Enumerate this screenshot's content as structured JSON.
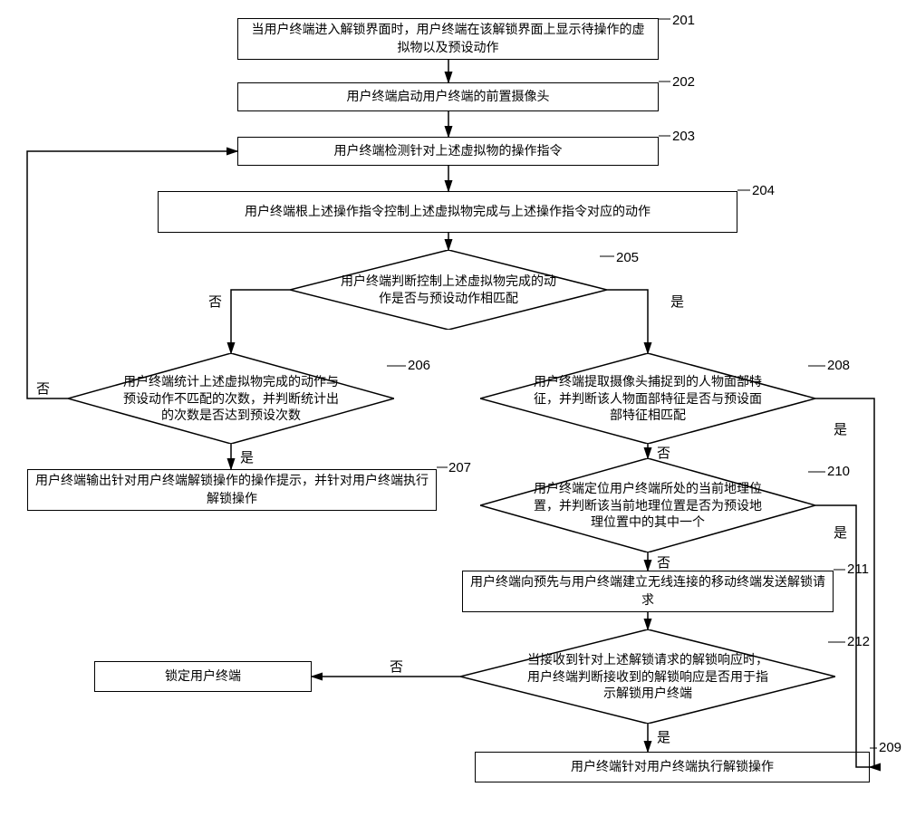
{
  "nodes": {
    "n201": "当用户终端进入解锁界面时，用户终端在该解锁界面上显示待操作的虚拟物以及预设动作",
    "n202": "用户终端启动用户终端的前置摄像头",
    "n203": "用户终端检测针对上述虚拟物的操作指令",
    "n204": "用户终端根上述操作指令控制上述虚拟物完成与上述操作指令对应的动作",
    "n205": "用户终端判断控制上述虚拟物完成的动作是否与预设动作相匹配",
    "n206": "用户终端统计上述虚拟物完成的动作与预设动作不匹配的次数，并判断统计出的次数是否达到预设次数",
    "n207": "用户终端输出针对用户终端解锁操作的操作提示，并针对用户终端执行解锁操作",
    "n208": "用户终端提取摄像头捕捉到的人物面部特征，并判断该人物面部特征是否与预设面部特征相匹配",
    "n209": "用户终端针对用户终端执行解锁操作",
    "n210": "用户终端定位用户终端所处的当前地理位置，并判断该当前地理位置是否为预设地理位置中的其中一个",
    "n211": "用户终端向预先与用户终端建立无线连接的移动终端发送解锁请求",
    "n212": "当接收到针对上述解锁请求的解锁响应时，用户终端判断接收到的解锁响应是否用于指示解锁用户终端",
    "nlock": "锁定用户终端"
  },
  "labels": {
    "l201": "201",
    "l202": "202",
    "l203": "203",
    "l204": "204",
    "l205": "205",
    "l206": "206",
    "l207": "207",
    "l208": "208",
    "l209": "209",
    "l210": "210",
    "l211": "211",
    "l212": "212"
  },
  "yn": {
    "yes": "是",
    "no": "否"
  },
  "chart_data": {
    "type": "flowchart",
    "nodes": [
      {
        "id": "201",
        "shape": "process",
        "text": "当用户终端进入解锁界面时，用户终端在该解锁界面上显示待操作的虚拟物以及预设动作"
      },
      {
        "id": "202",
        "shape": "process",
        "text": "用户终端启动用户终端的前置摄像头"
      },
      {
        "id": "203",
        "shape": "process",
        "text": "用户终端检测针对上述虚拟物的操作指令"
      },
      {
        "id": "204",
        "shape": "process",
        "text": "用户终端根上述操作指令控制上述虚拟物完成与上述操作指令对应的动作"
      },
      {
        "id": "205",
        "shape": "decision",
        "text": "用户终端判断控制上述虚拟物完成的动作是否与预设动作相匹配"
      },
      {
        "id": "206",
        "shape": "decision",
        "text": "用户终端统计上述虚拟物完成的动作与预设动作不匹配的次数，并判断统计出的次数是否达到预设次数"
      },
      {
        "id": "207",
        "shape": "process",
        "text": "用户终端输出针对用户终端解锁操作的操作提示，并针对用户终端执行解锁操作"
      },
      {
        "id": "208",
        "shape": "decision",
        "text": "用户终端提取摄像头捕捉到的人物面部特征，并判断该人物面部特征是否与预设面部特征相匹配"
      },
      {
        "id": "210",
        "shape": "decision",
        "text": "用户终端定位用户终端所处的当前地理位置，并判断该当前地理位置是否为预设地理位置中的其中一个"
      },
      {
        "id": "211",
        "shape": "process",
        "text": "用户终端向预先与用户终端建立无线连接的移动终端发送解锁请求"
      },
      {
        "id": "212",
        "shape": "decision",
        "text": "当接收到针对上述解锁请求的解锁响应时，用户终端判断接收到的解锁响应是否用于指示解锁用户终端"
      },
      {
        "id": "209",
        "shape": "process",
        "text": "用户终端针对用户终端执行解锁操作"
      },
      {
        "id": "lock",
        "shape": "process",
        "text": "锁定用户终端"
      }
    ],
    "edges": [
      {
        "from": "201",
        "to": "202"
      },
      {
        "from": "202",
        "to": "203"
      },
      {
        "from": "203",
        "to": "204"
      },
      {
        "from": "204",
        "to": "205"
      },
      {
        "from": "205",
        "to": "206",
        "label": "否"
      },
      {
        "from": "205",
        "to": "208",
        "label": "是"
      },
      {
        "from": "206",
        "to": "203",
        "label": "否"
      },
      {
        "from": "206",
        "to": "207",
        "label": "是"
      },
      {
        "from": "208",
        "to": "209",
        "label": "是"
      },
      {
        "from": "208",
        "to": "210",
        "label": "否"
      },
      {
        "from": "210",
        "to": "209",
        "label": "是"
      },
      {
        "from": "210",
        "to": "211",
        "label": "否"
      },
      {
        "from": "211",
        "to": "212"
      },
      {
        "from": "212",
        "to": "209",
        "label": "是"
      },
      {
        "from": "212",
        "to": "lock",
        "label": "否"
      }
    ]
  }
}
